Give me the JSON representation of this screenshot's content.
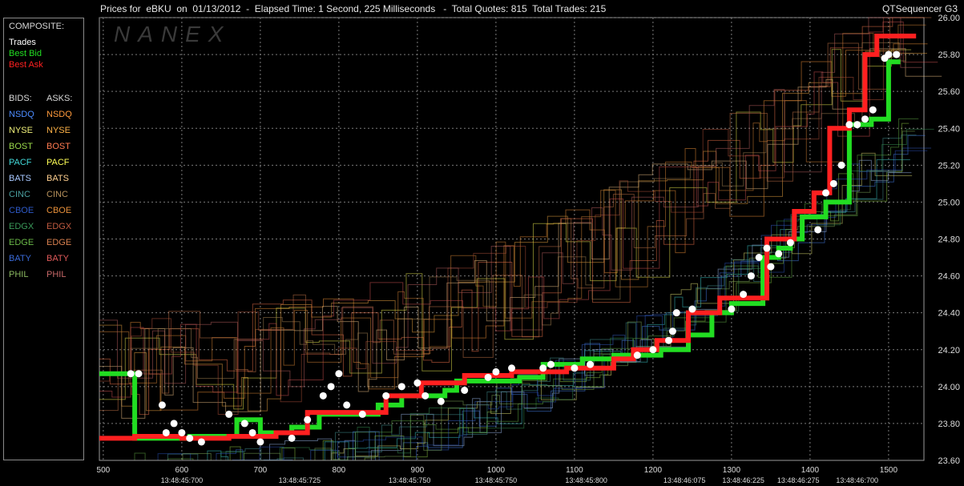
{
  "header": {
    "title": "Prices for  eBKU  on  01/13/2012  -  Elapsed Time: 1 Second, 225 Milliseconds   -  Total Quotes: 815  Total Trades: 215",
    "app_name": "QTSequencer G3"
  },
  "legend": {
    "composite_heading": "COMPOSITE:",
    "composite": [
      {
        "label": "Trades",
        "color": "#ffffff"
      },
      {
        "label": "Best Bid",
        "color": "#22dd22"
      },
      {
        "label": "Best Ask",
        "color": "#ff2020"
      }
    ],
    "bids_heading": "BIDS:",
    "asks_heading": "ASKS:",
    "exchanges": [
      {
        "bid": "NSDQ",
        "bid_color": "#4d8cff",
        "ask": "NSDQ",
        "ask_color": "#ff9a3c"
      },
      {
        "bid": "NYSE",
        "bid_color": "#f0f07a",
        "ask": "NYSE",
        "ask_color": "#ffb347"
      },
      {
        "bid": "BOST",
        "bid_color": "#9ad84a",
        "ask": "BOST",
        "ask_color": "#ff7a50"
      },
      {
        "bid": "PACF",
        "bid_color": "#42d8d8",
        "ask": "PACF",
        "ask_color": "#ffff55"
      },
      {
        "bid": "BATS",
        "bid_color": "#a8c8ff",
        "ask": "BATS",
        "ask_color": "#ffd090"
      },
      {
        "bid": "CINC",
        "bid_color": "#4aa0a0",
        "ask": "CINC",
        "ask_color": "#b8925c"
      },
      {
        "bid": "CBOE",
        "bid_color": "#2e5ac8",
        "ask": "CBOE",
        "ask_color": "#e8903a"
      },
      {
        "bid": "EDGX",
        "bid_color": "#3a9a5a",
        "ask": "EDGX",
        "ask_color": "#c05a40"
      },
      {
        "bid": "EDGE",
        "bid_color": "#6ab848",
        "ask": "EDGE",
        "ask_color": "#d88050"
      },
      {
        "bid": "BATY",
        "bid_color": "#3a6ad8",
        "ask": "BATY",
        "ask_color": "#e05a5a"
      },
      {
        "bid": "PHIL",
        "bid_color": "#8ab860",
        "ask": "PHIL",
        "ask_color": "#c86868"
      }
    ]
  },
  "chart_data": {
    "type": "line",
    "watermark": "NANEX",
    "x_range": [
      495,
      1545
    ],
    "y_range": [
      23.6,
      26.0
    ],
    "y_ticks": [
      "23.60",
      "23.80",
      "24.00",
      "24.20",
      "24.40",
      "24.60",
      "24.80",
      "25.00",
      "25.20",
      "25.40",
      "25.60",
      "25.80",
      "26.00"
    ],
    "x_ticks": [
      "500",
      "600",
      "700",
      "800",
      "900",
      "1000",
      "1100",
      "1200",
      "1300",
      "1400",
      "1500"
    ],
    "time_labels": [
      {
        "x": 600,
        "label": "13:48:45:700"
      },
      {
        "x": 750,
        "label": "13:48:45:725"
      },
      {
        "x": 890,
        "label": "13:48:45:750"
      },
      {
        "x": 1000,
        "label": "13:48:45:750"
      },
      {
        "x": 1115,
        "label": "13:48:45:800"
      },
      {
        "x": 1240,
        "label": "13:48:46:075"
      },
      {
        "x": 1315,
        "label": "13:48:46:225"
      },
      {
        "x": 1385,
        "label": "13:48:46:275"
      },
      {
        "x": 1460,
        "label": "13:48:46:700"
      }
    ],
    "grid": true,
    "legend_position": "left",
    "series": [
      {
        "name": "Best Bid",
        "color": "#22dd22",
        "points": [
          [
            495,
            24.07
          ],
          [
            540,
            24.07
          ],
          [
            540,
            23.72
          ],
          [
            610,
            23.72
          ],
          [
            610,
            23.73
          ],
          [
            670,
            23.73
          ],
          [
            670,
            23.82
          ],
          [
            700,
            23.82
          ],
          [
            700,
            23.75
          ],
          [
            740,
            23.75
          ],
          [
            740,
            23.78
          ],
          [
            775,
            23.78
          ],
          [
            775,
            23.85
          ],
          [
            850,
            23.85
          ],
          [
            850,
            23.9
          ],
          [
            880,
            23.9
          ],
          [
            880,
            23.95
          ],
          [
            935,
            23.95
          ],
          [
            935,
            23.98
          ],
          [
            950,
            23.98
          ],
          [
            950,
            24.03
          ],
          [
            1030,
            24.03
          ],
          [
            1030,
            24.05
          ],
          [
            1060,
            24.05
          ],
          [
            1060,
            24.12
          ],
          [
            1110,
            24.12
          ],
          [
            1110,
            24.15
          ],
          [
            1150,
            24.15
          ],
          [
            1150,
            24.17
          ],
          [
            1210,
            24.17
          ],
          [
            1210,
            24.2
          ],
          [
            1245,
            24.2
          ],
          [
            1245,
            24.28
          ],
          [
            1275,
            24.28
          ],
          [
            1275,
            24.4
          ],
          [
            1300,
            24.4
          ],
          [
            1300,
            24.45
          ],
          [
            1340,
            24.45
          ],
          [
            1340,
            24.7
          ],
          [
            1360,
            24.7
          ],
          [
            1360,
            24.75
          ],
          [
            1375,
            24.75
          ],
          [
            1375,
            24.8
          ],
          [
            1390,
            24.8
          ],
          [
            1390,
            24.92
          ],
          [
            1420,
            24.92
          ],
          [
            1420,
            25.0
          ],
          [
            1450,
            25.0
          ],
          [
            1450,
            25.42
          ],
          [
            1478,
            25.42
          ],
          [
            1478,
            25.45
          ],
          [
            1500,
            25.45
          ],
          [
            1500,
            25.76
          ],
          [
            1515,
            25.76
          ]
        ]
      },
      {
        "name": "Best Ask",
        "color": "#ff2020",
        "points": [
          [
            495,
            23.72
          ],
          [
            540,
            23.72
          ],
          [
            540,
            23.73
          ],
          [
            600,
            23.73
          ],
          [
            600,
            23.72
          ],
          [
            660,
            23.72
          ],
          [
            660,
            23.73
          ],
          [
            720,
            23.73
          ],
          [
            720,
            23.75
          ],
          [
            760,
            23.75
          ],
          [
            760,
            23.86
          ],
          [
            860,
            23.86
          ],
          [
            860,
            23.95
          ],
          [
            905,
            23.95
          ],
          [
            905,
            24.02
          ],
          [
            960,
            24.02
          ],
          [
            960,
            24.06
          ],
          [
            1020,
            24.06
          ],
          [
            1020,
            24.08
          ],
          [
            1090,
            24.08
          ],
          [
            1090,
            24.1
          ],
          [
            1150,
            24.1
          ],
          [
            1150,
            24.15
          ],
          [
            1175,
            24.15
          ],
          [
            1175,
            24.2
          ],
          [
            1205,
            24.2
          ],
          [
            1205,
            24.25
          ],
          [
            1245,
            24.25
          ],
          [
            1245,
            24.4
          ],
          [
            1285,
            24.4
          ],
          [
            1285,
            24.48
          ],
          [
            1345,
            24.48
          ],
          [
            1345,
            24.8
          ],
          [
            1380,
            24.8
          ],
          [
            1380,
            24.95
          ],
          [
            1405,
            24.95
          ],
          [
            1405,
            25.05
          ],
          [
            1425,
            25.05
          ],
          [
            1425,
            25.4
          ],
          [
            1450,
            25.4
          ],
          [
            1450,
            25.5
          ],
          [
            1470,
            25.5
          ],
          [
            1470,
            25.8
          ],
          [
            1485,
            25.8
          ],
          [
            1485,
            25.9
          ],
          [
            1535,
            25.9
          ]
        ]
      }
    ],
    "trades": [
      [
        535,
        24.07
      ],
      [
        545,
        24.07
      ],
      [
        575,
        23.9
      ],
      [
        580,
        23.75
      ],
      [
        590,
        23.8
      ],
      [
        600,
        23.75
      ],
      [
        610,
        23.72
      ],
      [
        625,
        23.7
      ],
      [
        660,
        23.85
      ],
      [
        680,
        23.8
      ],
      [
        690,
        23.75
      ],
      [
        700,
        23.7
      ],
      [
        740,
        23.72
      ],
      [
        760,
        23.82
      ],
      [
        780,
        23.95
      ],
      [
        790,
        24.0
      ],
      [
        800,
        24.07
      ],
      [
        810,
        23.9
      ],
      [
        830,
        23.85
      ],
      [
        860,
        23.95
      ],
      [
        880,
        24.0
      ],
      [
        900,
        24.02
      ],
      [
        910,
        23.95
      ],
      [
        930,
        23.92
      ],
      [
        960,
        23.98
      ],
      [
        990,
        24.05
      ],
      [
        1000,
        24.08
      ],
      [
        1020,
        24.1
      ],
      [
        1060,
        24.1
      ],
      [
        1070,
        24.12
      ],
      [
        1100,
        24.1
      ],
      [
        1120,
        24.12
      ],
      [
        1180,
        24.17
      ],
      [
        1200,
        24.2
      ],
      [
        1220,
        24.25
      ],
      [
        1225,
        24.3
      ],
      [
        1230,
        24.4
      ],
      [
        1250,
        24.42
      ],
      [
        1300,
        24.42
      ],
      [
        1315,
        24.5
      ],
      [
        1325,
        24.6
      ],
      [
        1335,
        24.7
      ],
      [
        1345,
        24.75
      ],
      [
        1350,
        24.65
      ],
      [
        1360,
        24.72
      ],
      [
        1375,
        24.78
      ],
      [
        1410,
        24.85
      ],
      [
        1420,
        25.05
      ],
      [
        1430,
        25.1
      ],
      [
        1440,
        25.2
      ],
      [
        1450,
        25.42
      ],
      [
        1460,
        25.42
      ],
      [
        1470,
        25.45
      ],
      [
        1480,
        25.5
      ],
      [
        1495,
        25.78
      ],
      [
        1500,
        25.8
      ],
      [
        1510,
        25.8
      ]
    ]
  }
}
